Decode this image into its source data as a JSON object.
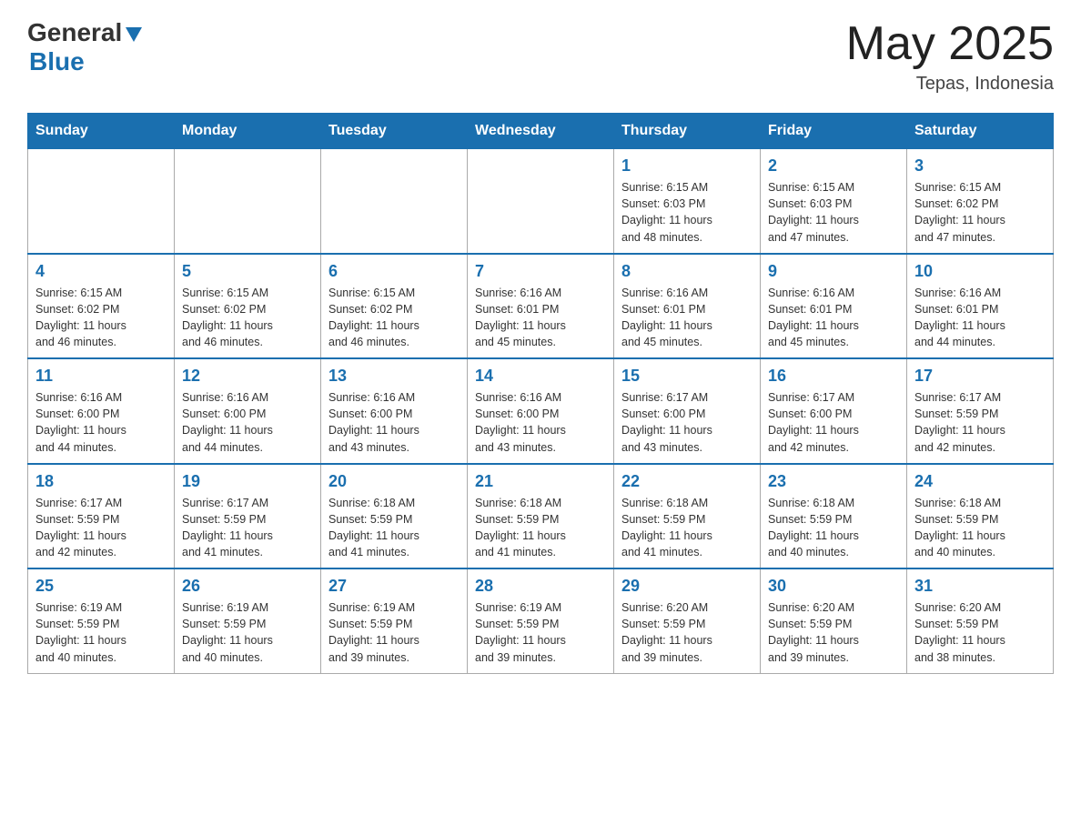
{
  "header": {
    "logo_general": "General",
    "logo_arrow": "▶",
    "logo_blue": "Blue",
    "month_year": "May 2025",
    "location": "Tepas, Indonesia"
  },
  "days_of_week": [
    "Sunday",
    "Monday",
    "Tuesday",
    "Wednesday",
    "Thursday",
    "Friday",
    "Saturday"
  ],
  "weeks": [
    [
      {
        "day": "",
        "info": ""
      },
      {
        "day": "",
        "info": ""
      },
      {
        "day": "",
        "info": ""
      },
      {
        "day": "",
        "info": ""
      },
      {
        "day": "1",
        "info": "Sunrise: 6:15 AM\nSunset: 6:03 PM\nDaylight: 11 hours\nand 48 minutes."
      },
      {
        "day": "2",
        "info": "Sunrise: 6:15 AM\nSunset: 6:03 PM\nDaylight: 11 hours\nand 47 minutes."
      },
      {
        "day": "3",
        "info": "Sunrise: 6:15 AM\nSunset: 6:02 PM\nDaylight: 11 hours\nand 47 minutes."
      }
    ],
    [
      {
        "day": "4",
        "info": "Sunrise: 6:15 AM\nSunset: 6:02 PM\nDaylight: 11 hours\nand 46 minutes."
      },
      {
        "day": "5",
        "info": "Sunrise: 6:15 AM\nSunset: 6:02 PM\nDaylight: 11 hours\nand 46 minutes."
      },
      {
        "day": "6",
        "info": "Sunrise: 6:15 AM\nSunset: 6:02 PM\nDaylight: 11 hours\nand 46 minutes."
      },
      {
        "day": "7",
        "info": "Sunrise: 6:16 AM\nSunset: 6:01 PM\nDaylight: 11 hours\nand 45 minutes."
      },
      {
        "day": "8",
        "info": "Sunrise: 6:16 AM\nSunset: 6:01 PM\nDaylight: 11 hours\nand 45 minutes."
      },
      {
        "day": "9",
        "info": "Sunrise: 6:16 AM\nSunset: 6:01 PM\nDaylight: 11 hours\nand 45 minutes."
      },
      {
        "day": "10",
        "info": "Sunrise: 6:16 AM\nSunset: 6:01 PM\nDaylight: 11 hours\nand 44 minutes."
      }
    ],
    [
      {
        "day": "11",
        "info": "Sunrise: 6:16 AM\nSunset: 6:00 PM\nDaylight: 11 hours\nand 44 minutes."
      },
      {
        "day": "12",
        "info": "Sunrise: 6:16 AM\nSunset: 6:00 PM\nDaylight: 11 hours\nand 44 minutes."
      },
      {
        "day": "13",
        "info": "Sunrise: 6:16 AM\nSunset: 6:00 PM\nDaylight: 11 hours\nand 43 minutes."
      },
      {
        "day": "14",
        "info": "Sunrise: 6:16 AM\nSunset: 6:00 PM\nDaylight: 11 hours\nand 43 minutes."
      },
      {
        "day": "15",
        "info": "Sunrise: 6:17 AM\nSunset: 6:00 PM\nDaylight: 11 hours\nand 43 minutes."
      },
      {
        "day": "16",
        "info": "Sunrise: 6:17 AM\nSunset: 6:00 PM\nDaylight: 11 hours\nand 42 minutes."
      },
      {
        "day": "17",
        "info": "Sunrise: 6:17 AM\nSunset: 5:59 PM\nDaylight: 11 hours\nand 42 minutes."
      }
    ],
    [
      {
        "day": "18",
        "info": "Sunrise: 6:17 AM\nSunset: 5:59 PM\nDaylight: 11 hours\nand 42 minutes."
      },
      {
        "day": "19",
        "info": "Sunrise: 6:17 AM\nSunset: 5:59 PM\nDaylight: 11 hours\nand 41 minutes."
      },
      {
        "day": "20",
        "info": "Sunrise: 6:18 AM\nSunset: 5:59 PM\nDaylight: 11 hours\nand 41 minutes."
      },
      {
        "day": "21",
        "info": "Sunrise: 6:18 AM\nSunset: 5:59 PM\nDaylight: 11 hours\nand 41 minutes."
      },
      {
        "day": "22",
        "info": "Sunrise: 6:18 AM\nSunset: 5:59 PM\nDaylight: 11 hours\nand 41 minutes."
      },
      {
        "day": "23",
        "info": "Sunrise: 6:18 AM\nSunset: 5:59 PM\nDaylight: 11 hours\nand 40 minutes."
      },
      {
        "day": "24",
        "info": "Sunrise: 6:18 AM\nSunset: 5:59 PM\nDaylight: 11 hours\nand 40 minutes."
      }
    ],
    [
      {
        "day": "25",
        "info": "Sunrise: 6:19 AM\nSunset: 5:59 PM\nDaylight: 11 hours\nand 40 minutes."
      },
      {
        "day": "26",
        "info": "Sunrise: 6:19 AM\nSunset: 5:59 PM\nDaylight: 11 hours\nand 40 minutes."
      },
      {
        "day": "27",
        "info": "Sunrise: 6:19 AM\nSunset: 5:59 PM\nDaylight: 11 hours\nand 39 minutes."
      },
      {
        "day": "28",
        "info": "Sunrise: 6:19 AM\nSunset: 5:59 PM\nDaylight: 11 hours\nand 39 minutes."
      },
      {
        "day": "29",
        "info": "Sunrise: 6:20 AM\nSunset: 5:59 PM\nDaylight: 11 hours\nand 39 minutes."
      },
      {
        "day": "30",
        "info": "Sunrise: 6:20 AM\nSunset: 5:59 PM\nDaylight: 11 hours\nand 39 minutes."
      },
      {
        "day": "31",
        "info": "Sunrise: 6:20 AM\nSunset: 5:59 PM\nDaylight: 11 hours\nand 38 minutes."
      }
    ]
  ]
}
